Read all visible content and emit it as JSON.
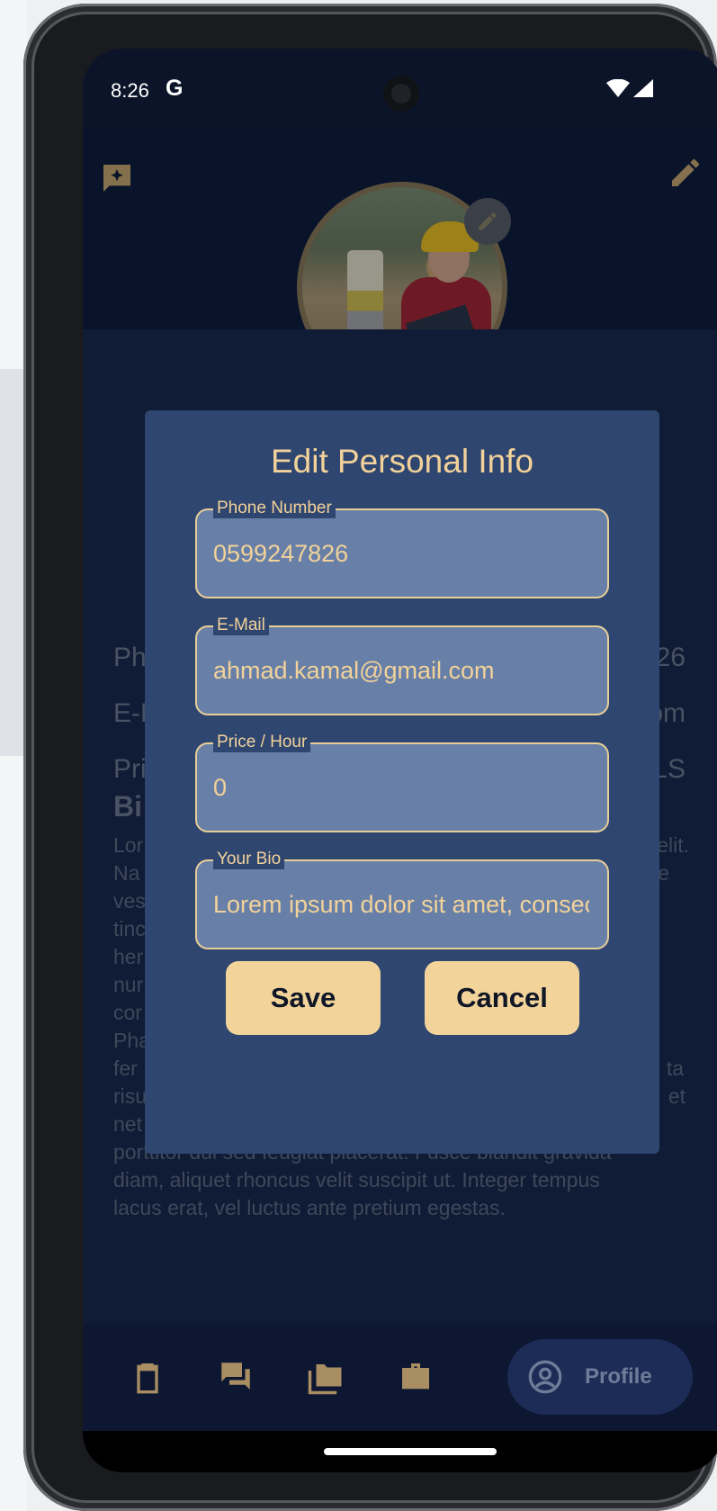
{
  "status_bar": {
    "time": "8:26",
    "carrier_logo": "G"
  },
  "header": {
    "left_icon": "chat-add-icon",
    "right_icon": "edit-icon"
  },
  "profile_info": {
    "rows": [
      {
        "label": "Ph",
        "value": "26"
      },
      {
        "label": "E-N",
        "value": "om"
      },
      {
        "label": "Pri",
        "value": "LS"
      }
    ],
    "bio_heading": "Bi",
    "bio_lines": [
      "Lor",
      "Na",
      "ves",
      "tinc",
      "her",
      "nur",
      "cor",
      "Pha",
      "fer",
      "risu",
      "net",
      "porttitor dui sed feugiat placerat. Fusce blandit gravida",
      "diam, aliquet rhoncus velit suscipit ut. Integer tempus",
      "lacus erat, vel luctus ante pretium egestas."
    ],
    "bio_line_ends": [
      "elit.",
      "ie",
      "",
      "",
      "",
      "",
      "",
      "",
      "ta",
      "et",
      "",
      "",
      "",
      ""
    ]
  },
  "dialog": {
    "title": "Edit Personal Info",
    "fields": [
      {
        "label": "Phone Number",
        "value": "0599247826"
      },
      {
        "label": "E-Mail",
        "value": "ahmad.kamal@gmail.com"
      },
      {
        "label": "Price / Hour",
        "value": "0"
      },
      {
        "label": "Your Bio",
        "value": "Lorem ipsum dolor sit amet, consectetur adipiscing elit."
      }
    ],
    "save_label": "Save",
    "cancel_label": "Cancel"
  },
  "bottom_nav": {
    "items": [
      {
        "icon": "clipboard-icon"
      },
      {
        "icon": "chat-icon"
      },
      {
        "icon": "folder-icon"
      },
      {
        "icon": "briefcase-icon"
      }
    ],
    "active_label": "Profile",
    "active_icon": "account-circle-icon"
  },
  "colors": {
    "accent": "#f2d49b",
    "dialog_bg": "#2f4670",
    "field_bg": "#6880a7",
    "screen_bg": "#172747"
  }
}
